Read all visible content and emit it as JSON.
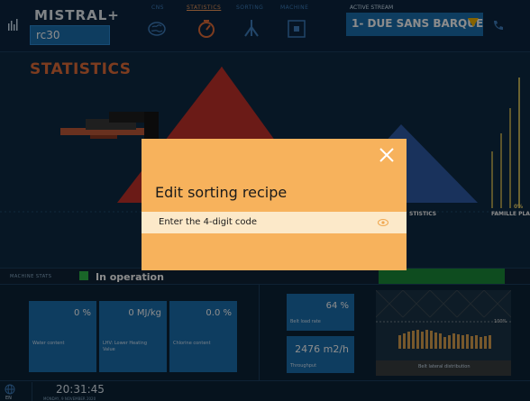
{
  "header": {
    "brand": "MISTRAL+",
    "machine_id": "rc30",
    "nav": [
      {
        "label": "CNS",
        "icon": "brain-icon",
        "active": false
      },
      {
        "label": "STATISTICS",
        "icon": "gauge-icon",
        "active": true
      },
      {
        "label": "SORTING",
        "icon": "sorting-icon",
        "active": false
      },
      {
        "label": "MACHINE",
        "icon": "machine-icon",
        "active": false
      }
    ],
    "stream_label": "ACTIVE STREAM",
    "stream_value": "1- DUE SANS BARQUETTE"
  },
  "page": {
    "title": "STATISTICS",
    "right_labels": {
      "stistics": "STISTICS",
      "pct": "0%",
      "famille": "FAMILLE PLA",
      "pct100": "100%"
    }
  },
  "machine_stats": {
    "label": "MACHINE STATS",
    "status": "In operation",
    "status_color": "#2fb84a"
  },
  "cards": [
    {
      "value": "0 %",
      "caption": "Water content"
    },
    {
      "value": "0 MJ/kg",
      "caption": "LHV: Lower Heating Value"
    },
    {
      "value": "0.0 %",
      "caption": "Chlorine content"
    }
  ],
  "belt": {
    "load_rate_value": "64 %",
    "load_rate_caption": "Belt load rate",
    "throughput_value": "2476 m2/h",
    "throughput_caption": "Throughput",
    "distribution_caption": "Belt lateral distribution"
  },
  "footer": {
    "time": "20:31:45",
    "date": "MONDAY, 9 NOVEMBER 2020",
    "lang": "EN"
  },
  "modal": {
    "title": "Edit sorting recipe",
    "field_placeholder": "Enter the 4-digit code"
  },
  "colors": {
    "accent": "#e46d3a",
    "panel_blue": "#1b6fb0",
    "modal_bg": "#f7b25c"
  }
}
